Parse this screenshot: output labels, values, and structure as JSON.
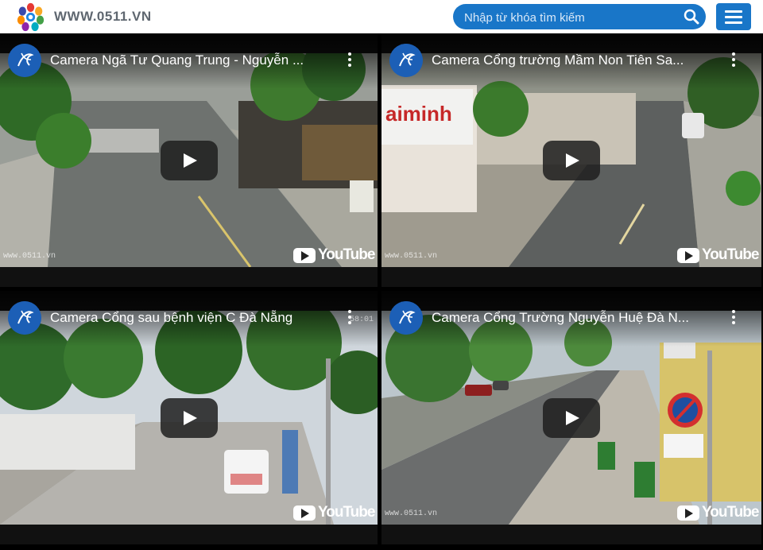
{
  "header": {
    "site_name": "WWW.0511.VN",
    "search_placeholder": "Nhập từ khóa tìm kiếm"
  },
  "player": {
    "youtube_label": "YouTube",
    "watermark": "www.0511.vn"
  },
  "videos": [
    {
      "title": "Camera Ngã Tư Quang Trung - Nguyễn ..."
    },
    {
      "title": "Camera Cổng trường Mầm Non Tiên Sa..."
    },
    {
      "title": "Camera Cổng sau bệnh viện C Đà Nẵng",
      "overlay_time": "58:01"
    },
    {
      "title": "Camera Cổng Trường Nguyễn Huệ Đà N..."
    }
  ],
  "colors": {
    "accent": "#1976c8",
    "header_text": "#5f6770"
  }
}
